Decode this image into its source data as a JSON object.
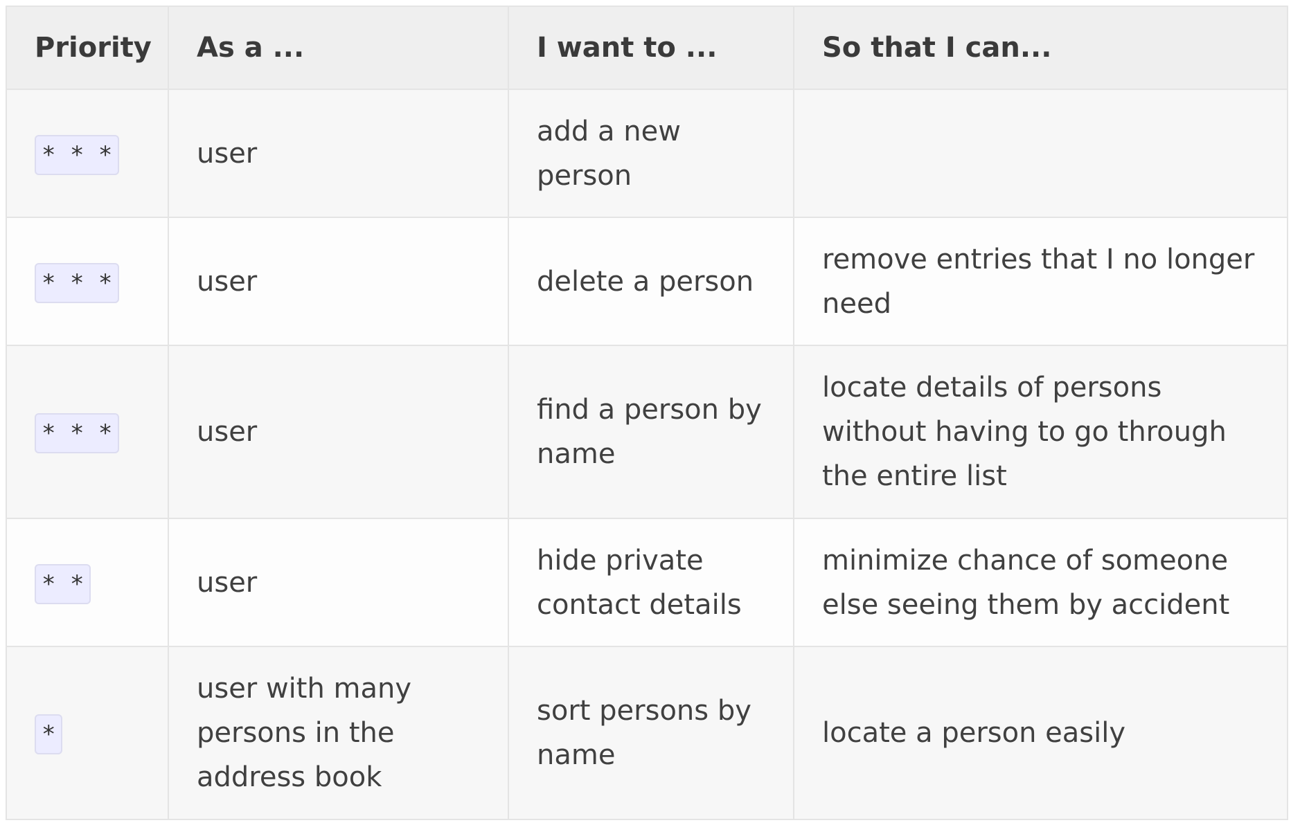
{
  "table": {
    "headers": [
      "Priority",
      "As a ...",
      "I want to ...",
      "So that I can..."
    ],
    "rows": [
      {
        "priority": "* * *",
        "as_a": "user",
        "want": "add a new person",
        "so_that": ""
      },
      {
        "priority": "* * *",
        "as_a": "user",
        "want": "delete a person",
        "so_that": "remove entries that I no longer need"
      },
      {
        "priority": "* * *",
        "as_a": "user",
        "want": "find a person by name",
        "so_that": "locate details of persons without having to go through the entire list"
      },
      {
        "priority": "* *",
        "as_a": "user",
        "want": "hide private contact details",
        "so_that": "minimize chance of someone else seeing them by accident"
      },
      {
        "priority": "*",
        "as_a": "user with many persons in the address book",
        "want": "sort persons by name",
        "so_that": "locate a person easily"
      }
    ]
  }
}
